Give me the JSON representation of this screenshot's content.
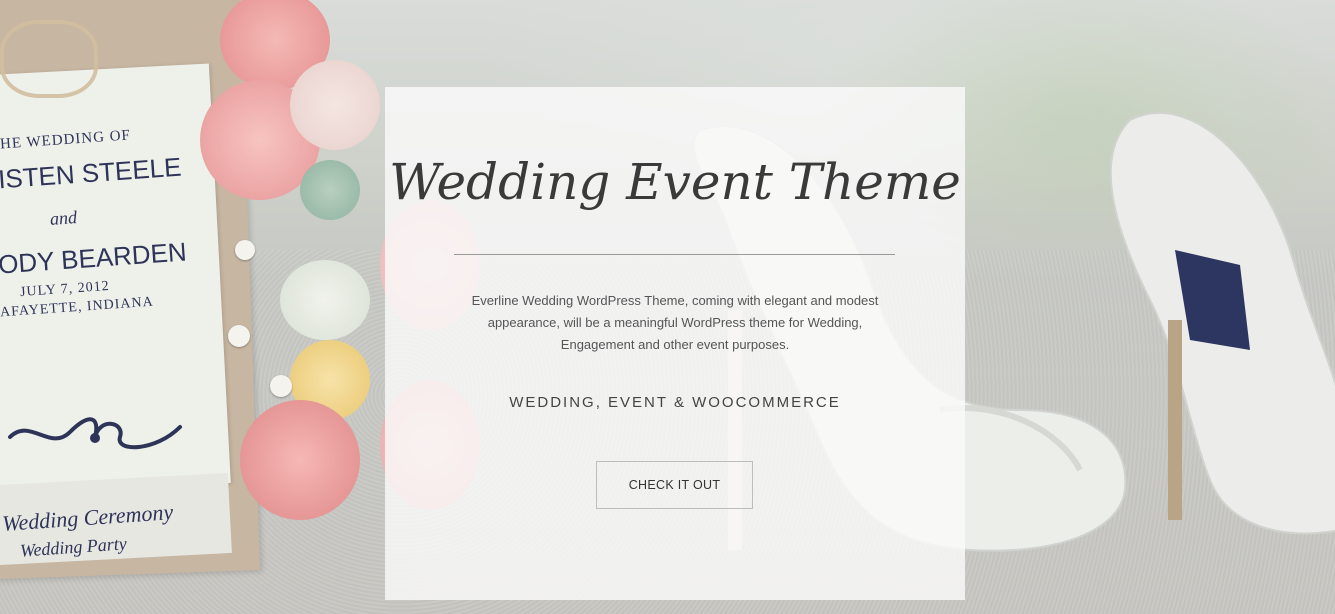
{
  "background": {
    "invitation_card": {
      "line1": "HE WEDDING OF",
      "line2": "ISTEN STEELE",
      "line3": "and",
      "line4": "ODY BEARDEN",
      "line5": "JULY 7, 2012",
      "line6": "AFAYETTE, INDIANA",
      "line7": "Wedding Ceremony",
      "line8": "Wedding Party"
    }
  },
  "hero": {
    "title": "Wedding Event Theme",
    "description": "Everline Wedding WordPress Theme, coming with elegant and modest appearance, will be a meaningful WordPress theme for Wedding, Engagement and other event purposes.",
    "tagline": "WEDDING, EVENT & WOOCOMMERCE",
    "cta_label": "CHECK IT OUT"
  },
  "colors": {
    "panel": "#fafafa",
    "title": "#3a3a3a",
    "text": "#555555",
    "border": "#bdbdbd"
  }
}
